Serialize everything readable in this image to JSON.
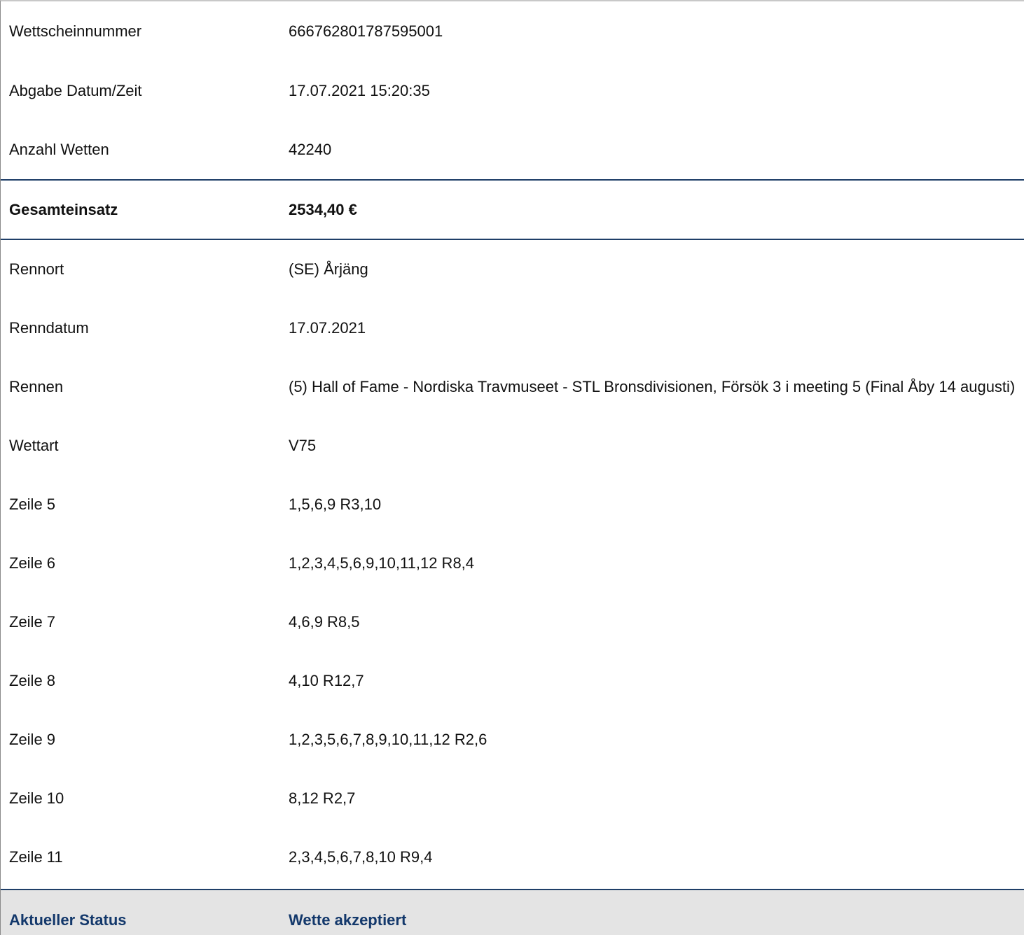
{
  "header_rows": [
    {
      "label": "Wettscheinnummer",
      "value": "666762801787595001"
    },
    {
      "label": "Abgabe Datum/Zeit",
      "value": "17.07.2021 15:20:35"
    },
    {
      "label": "Anzahl Wetten",
      "value": "42240"
    }
  ],
  "total": {
    "label": "Gesamteinsatz",
    "value": "2534,40 €"
  },
  "detail_rows": [
    {
      "label": "Rennort",
      "value": "(SE) Årjäng"
    },
    {
      "label": "Renndatum",
      "value": "17.07.2021"
    },
    {
      "label": "Rennen",
      "value": "(5) Hall of Fame - Nordiska Travmuseet - STL Bronsdivisionen, Försök 3 i meeting 5 (Final Åby 14 augusti)"
    },
    {
      "label": "Wettart",
      "value": "V75"
    },
    {
      "label": "Zeile 5",
      "value": "1,5,6,9 R3,10"
    },
    {
      "label": "Zeile 6",
      "value": "1,2,3,4,5,6,9,10,11,12 R8,4"
    },
    {
      "label": "Zeile 7",
      "value": "4,6,9 R8,5"
    },
    {
      "label": "Zeile 8",
      "value": "4,10 R12,7"
    },
    {
      "label": "Zeile 9",
      "value": "1,2,3,5,6,7,8,9,10,11,12 R2,6"
    },
    {
      "label": "Zeile 10",
      "value": "8,12 R2,7"
    },
    {
      "label": "Zeile 11",
      "value": "2,3,4,5,6,7,8,10 R9,4"
    }
  ],
  "status": {
    "label": "Aktueller Status",
    "value": "Wette akzeptiert"
  },
  "colors": {
    "accent": "#1f3f68",
    "status_text": "#13386b",
    "status_bg": "#e4e4e4"
  }
}
